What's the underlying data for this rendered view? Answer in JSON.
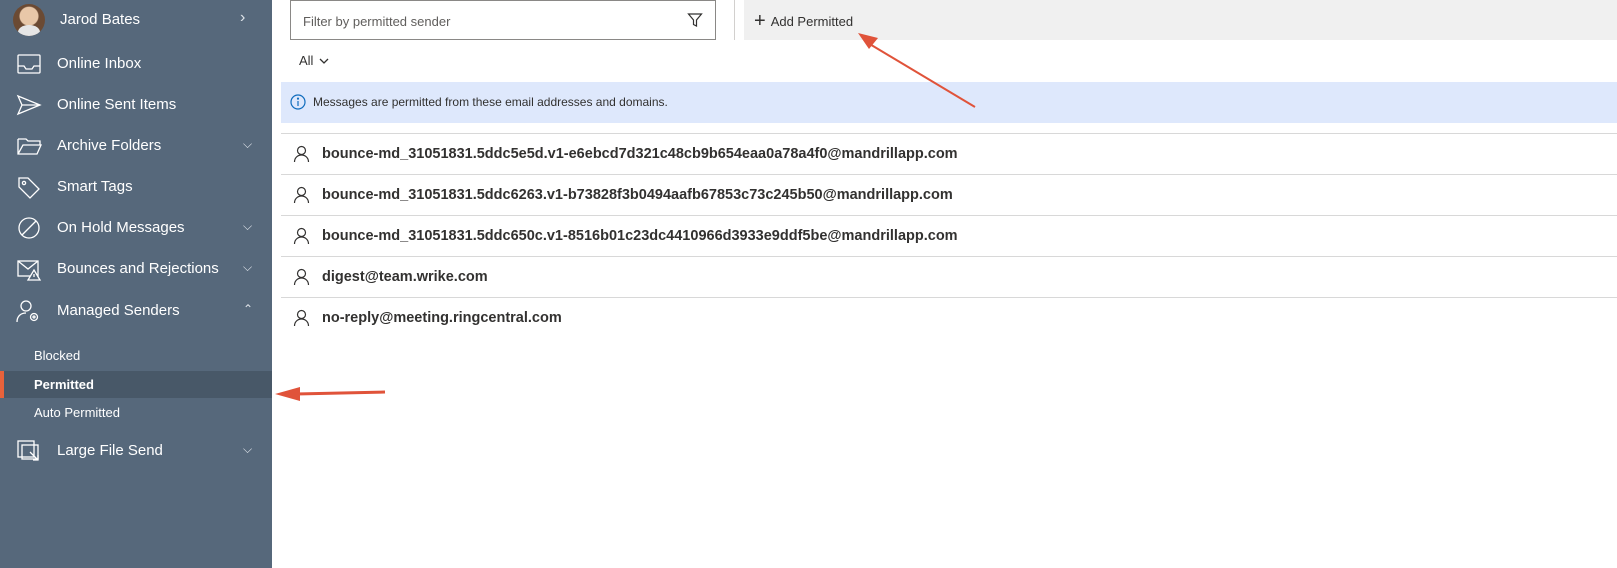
{
  "sidebar": {
    "user": {
      "name": "Jarod Bates",
      "chevron": "›"
    },
    "items": [
      {
        "label": "Online Inbox",
        "icon": "inbox-icon"
      },
      {
        "label": "Online Sent Items",
        "icon": "send-icon"
      },
      {
        "label": "Archive Folders",
        "icon": "folder-icon",
        "chevron": "⌄"
      },
      {
        "label": "Smart Tags",
        "icon": "tag-icon"
      },
      {
        "label": "On Hold Messages",
        "icon": "block-icon",
        "chevron": "⌄"
      },
      {
        "label": "Bounces and Rejections",
        "icon": "mail-warning-icon",
        "chevron": "⌄"
      },
      {
        "label": "Managed Senders",
        "icon": "person-settings-icon",
        "chevron": "⌃"
      },
      {
        "label": "Large File Send",
        "icon": "large-file-icon",
        "chevron": "⌄"
      }
    ],
    "sub_items": [
      {
        "label": "Blocked"
      },
      {
        "label": "Permitted",
        "active": true
      },
      {
        "label": "Auto Permitted"
      }
    ]
  },
  "filter": {
    "placeholder": "Filter by permitted sender"
  },
  "toolbar": {
    "add_label": "Add Permitted",
    "add_icon": "plus-icon"
  },
  "view_filter": {
    "selected": "All"
  },
  "info_banner": {
    "text": "Messages are permitted from these email addresses and domains.",
    "icon": "info-icon"
  },
  "senders": [
    "bounce-md_31051831.5ddc5e5d.v1-e6ebcd7d321c48cb9b654eaa0a78a4f0@mandrillapp.com",
    "bounce-md_31051831.5ddc6263.v1-b73828f3b0494aafb67853c73c245b50@mandrillapp.com",
    "bounce-md_31051831.5ddc650c.v1-8516b01c23dc4410966d3933e9ddf5be@mandrillapp.com",
    "digest@team.wrike.com",
    "no-reply@meeting.ringcentral.com"
  ],
  "colors": {
    "sidebar_bg": "#56687b",
    "active_accent": "#e8623b",
    "info_bg": "#dee8fc",
    "annotation_arrow": "#e0533a"
  }
}
